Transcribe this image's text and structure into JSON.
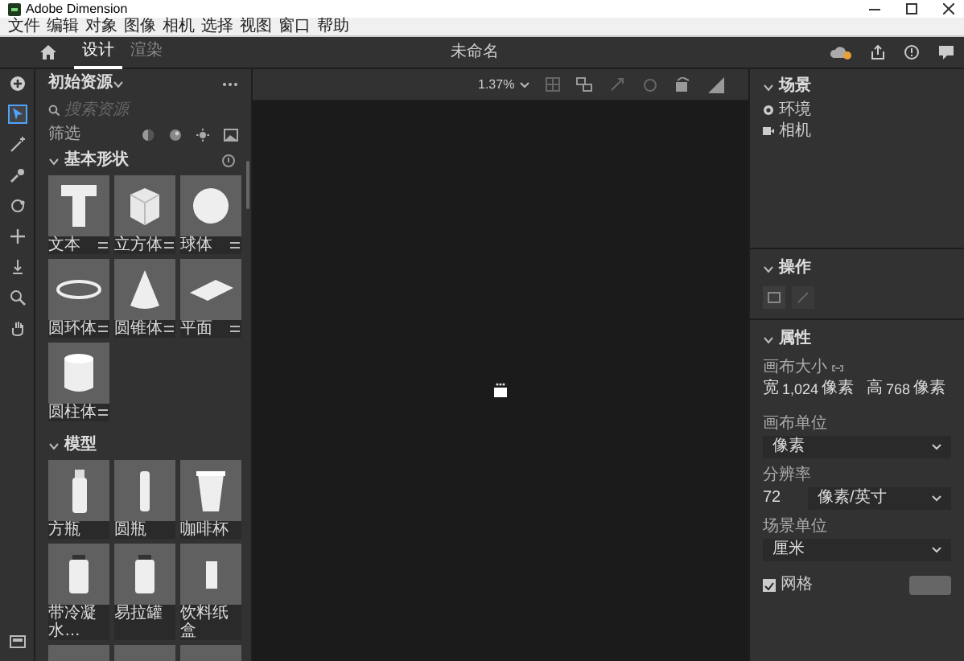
{
  "window": {
    "title": "Adobe Dimension"
  },
  "menu": [
    "文件",
    "编辑",
    "对象",
    "图像",
    "相机",
    "选择",
    "视图",
    "窗口",
    "帮助"
  ],
  "tabs": [
    {
      "label": "设计",
      "selected": true
    },
    {
      "label": "渲染",
      "selected": false
    }
  ],
  "document_title": "未命名",
  "tools": [
    {
      "kind": "add",
      "selected": false
    },
    {
      "kind": "select",
      "selected": true
    },
    {
      "kind": "wand",
      "selected": false
    },
    {
      "kind": "brush",
      "selected": false
    },
    {
      "kind": "orbit",
      "selected": false
    },
    {
      "kind": "pan",
      "selected": false
    },
    {
      "kind": "dolly",
      "selected": false
    },
    {
      "kind": "zoom",
      "selected": false
    },
    {
      "kind": "hand",
      "selected": false
    }
  ],
  "assets": {
    "title": "初始资源",
    "search": {
      "placeholder": "搜索资源"
    },
    "filter_label": "筛选",
    "sections": [
      {
        "title": "基本形状",
        "kind": "basic",
        "expanded": true,
        "items": [
          {
            "label": "文本",
            "kind": "text"
          },
          {
            "label": "立方体",
            "kind": "cube"
          },
          {
            "label": "球体",
            "kind": "sphere"
          },
          {
            "label": "圆环体",
            "kind": "torus"
          },
          {
            "label": "圆锥体",
            "kind": "cone"
          },
          {
            "label": "平面",
            "kind": "plane"
          },
          {
            "label": "圆柱体",
            "kind": "cylinder"
          }
        ]
      },
      {
        "title": "模型",
        "kind": "models",
        "expanded": true,
        "items": [
          {
            "label": "方瓶",
            "kind": "bottle"
          },
          {
            "label": "圆瓶",
            "kind": "slim"
          },
          {
            "label": "咖啡杯",
            "kind": "cup"
          },
          {
            "label": "带冷凝水…",
            "kind": "can"
          },
          {
            "label": "易拉罐",
            "kind": "can"
          },
          {
            "label": "饮料纸盒",
            "kind": "carton"
          },
          {
            "kind": "box"
          },
          {
            "kind": "box"
          },
          {
            "kind": "box"
          }
        ]
      }
    ]
  },
  "zoom": "1.37%",
  "scene": {
    "title": "场景",
    "expanded": true,
    "items": [
      {
        "label": "环境",
        "kind": "environment"
      },
      {
        "label": "相机",
        "kind": "camera"
      }
    ]
  },
  "actions": {
    "title": "操作",
    "expanded": true
  },
  "properties": {
    "title": "属性",
    "expanded": true,
    "canvas_size_label": "画布大小",
    "width_label": "宽",
    "width_value": "1,024",
    "width_unit": "像素",
    "height_label": "高",
    "height_value": "768",
    "height_unit": "像素",
    "canvas_unit_label": "画布单位",
    "canvas_unit": "像素",
    "resolution_label": "分辨率",
    "resolution": "72",
    "resolution_unit": "像素/英寸",
    "scene_unit_label": "场景单位",
    "scene_unit": "厘米",
    "grid": {
      "label": "网格",
      "checked": true
    }
  }
}
